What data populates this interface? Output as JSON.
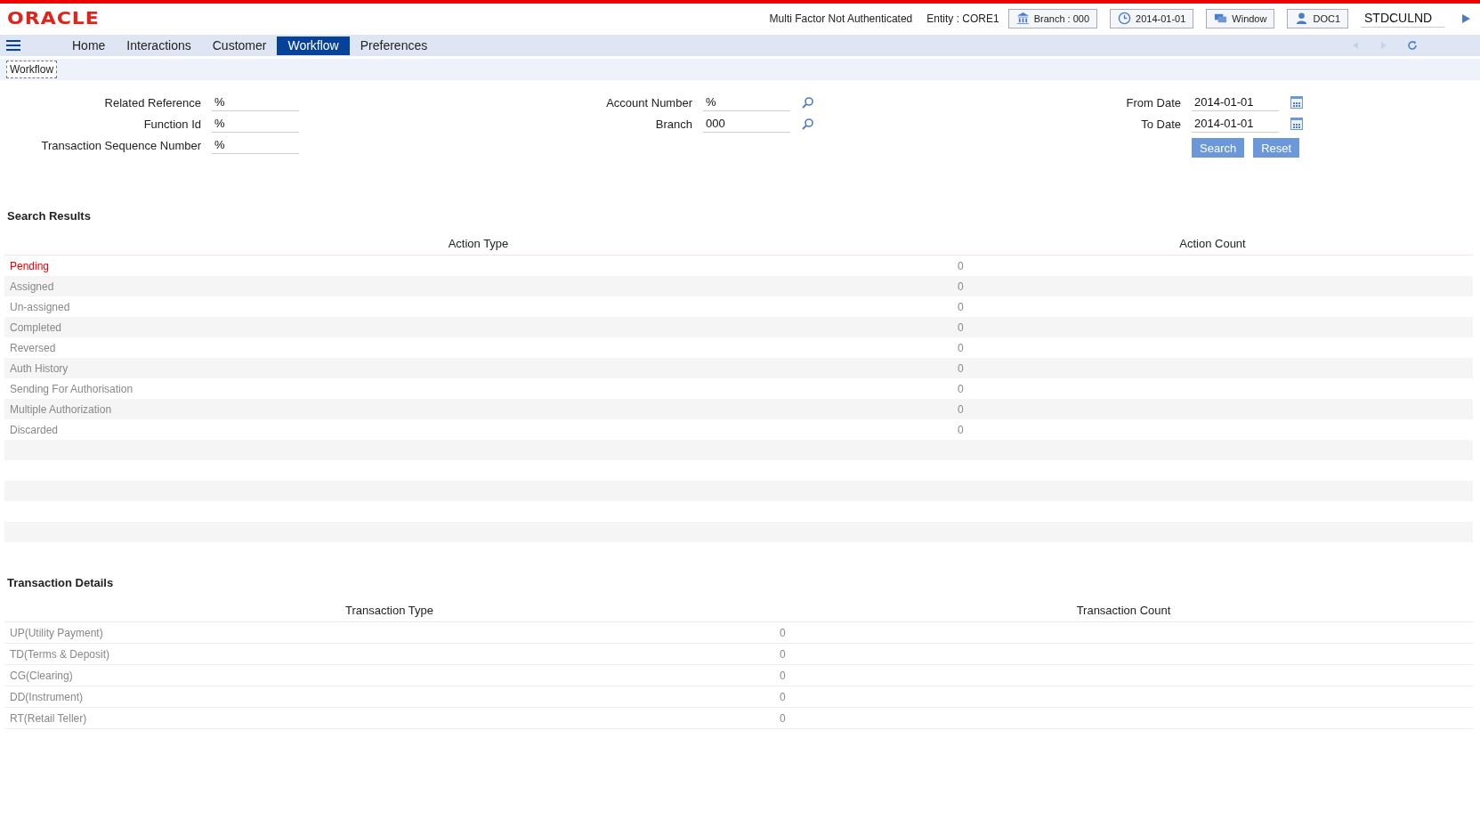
{
  "header": {
    "logo": "ORACLE",
    "mfa_status": "Multi Factor Not Authenticated",
    "entity": "Entity : CORE1",
    "branch_button": "Branch : 000",
    "date_button": "2014-01-01",
    "window_button": "Window",
    "user_button": "DOC1",
    "user_field": "STDCULND"
  },
  "menu": [
    {
      "label": "Home",
      "selected": false
    },
    {
      "label": "Interactions",
      "selected": false
    },
    {
      "label": "Customer",
      "selected": false
    },
    {
      "label": "Workflow",
      "selected": true
    },
    {
      "label": "Preferences",
      "selected": false
    }
  ],
  "breadcrumb": "Workflow",
  "form": {
    "columns": [
      [
        {
          "label": "Related Reference",
          "value": "%",
          "kind": "text"
        },
        {
          "label": "Function Id",
          "value": "%",
          "kind": "text"
        },
        {
          "label": "Transaction Sequence Number",
          "value": "%",
          "kind": "text"
        }
      ],
      [
        {
          "label": "Account Number",
          "value": "%",
          "kind": "lookup"
        },
        {
          "label": "Branch",
          "value": "000",
          "kind": "lookup"
        }
      ],
      [
        {
          "label": "From Date",
          "value": "2014-01-01",
          "kind": "date"
        },
        {
          "label": "To Date",
          "value": "2014-01-01",
          "kind": "date"
        }
      ]
    ],
    "buttons": [
      "Search",
      "Reset"
    ]
  },
  "search_results": {
    "title": "Search Results",
    "columns": [
      "Action Type",
      "Action Count"
    ],
    "rows": [
      {
        "type": "Pending",
        "count": "0",
        "selected": true
      },
      {
        "type": "Assigned",
        "count": "0",
        "selected": false
      },
      {
        "type": "Un-assigned",
        "count": "0",
        "selected": false
      },
      {
        "type": "Completed",
        "count": "0",
        "selected": false
      },
      {
        "type": "Reversed",
        "count": "0",
        "selected": false
      },
      {
        "type": "Auth History",
        "count": "0",
        "selected": false
      },
      {
        "type": "Sending For Authorisation",
        "count": "0",
        "selected": false
      },
      {
        "type": "Multiple Authorization",
        "count": "0",
        "selected": false
      },
      {
        "type": "Discarded",
        "count": "0",
        "selected": false
      }
    ]
  },
  "transaction_details": {
    "title": "Transaction Details",
    "columns": [
      "Transaction Type",
      "Transaction Count"
    ],
    "rows": [
      {
        "type": "UP(Utility Payment)",
        "count": "0",
        "selected": false
      },
      {
        "type": "TD(Terms & Deposit)",
        "count": "0",
        "selected": false
      },
      {
        "type": "CG(Clearing)",
        "count": "0",
        "selected": false
      },
      {
        "type": "DD(Instrument)",
        "count": "0",
        "selected": false
      },
      {
        "type": "RT(Retail Teller)",
        "count": "0",
        "selected": false
      }
    ]
  }
}
